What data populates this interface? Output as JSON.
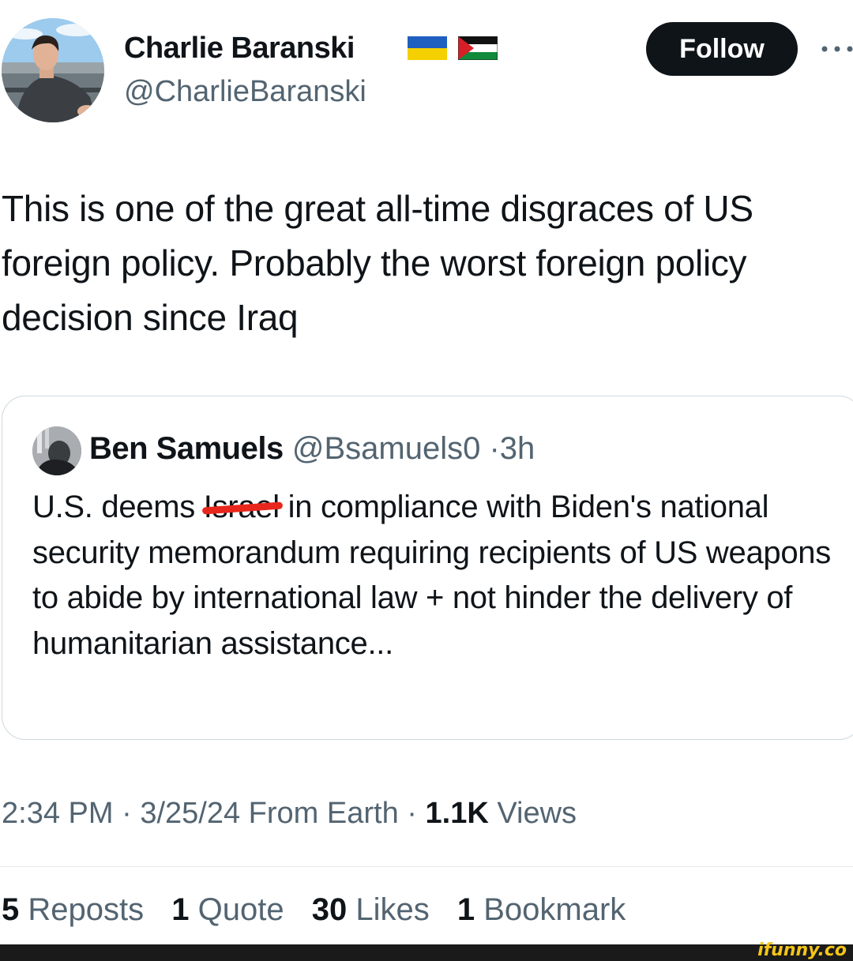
{
  "author": {
    "name": "Charlie Baranski",
    "handle": "@CharlieBaranski",
    "flags": [
      "ukraine-flag",
      "palestine-flag"
    ]
  },
  "actions": {
    "follow_label": "Follow",
    "more_icon": "more-horizontal-icon"
  },
  "tweet": {
    "text": "This is one of the great all-time disgraces of US foreign policy. Probably the worst foreign policy decision since Iraq"
  },
  "quoted": {
    "name": "Ben Samuels",
    "handle": "@Bsamuels0",
    "separator": "·",
    "time": "3h",
    "text_before": "U.S. deems ",
    "redacted_word": "Israel",
    "text_after": " in compliance with Biden's national security memorandum requiring recipients of US weapons to abide by international law + not hinder the delivery of humanitarian assistance..."
  },
  "meta": {
    "time": "2:34 PM",
    "date": "3/25/24",
    "source": "From Earth",
    "views_count": "1.1K",
    "views_label": "Views",
    "sep": " · "
  },
  "stats": [
    {
      "count": "5",
      "label": "Reposts"
    },
    {
      "count": "1",
      "label": "Quote"
    },
    {
      "count": "30",
      "label": "Likes"
    },
    {
      "count": "1",
      "label": "Bookmark"
    }
  ],
  "watermark": "ifunny.co",
  "colors": {
    "text": "#0f1419",
    "secondary": "#536471",
    "border": "#cfd9de",
    "redaction": "#e8261c",
    "ifunny_yellow": "#f5c518"
  }
}
